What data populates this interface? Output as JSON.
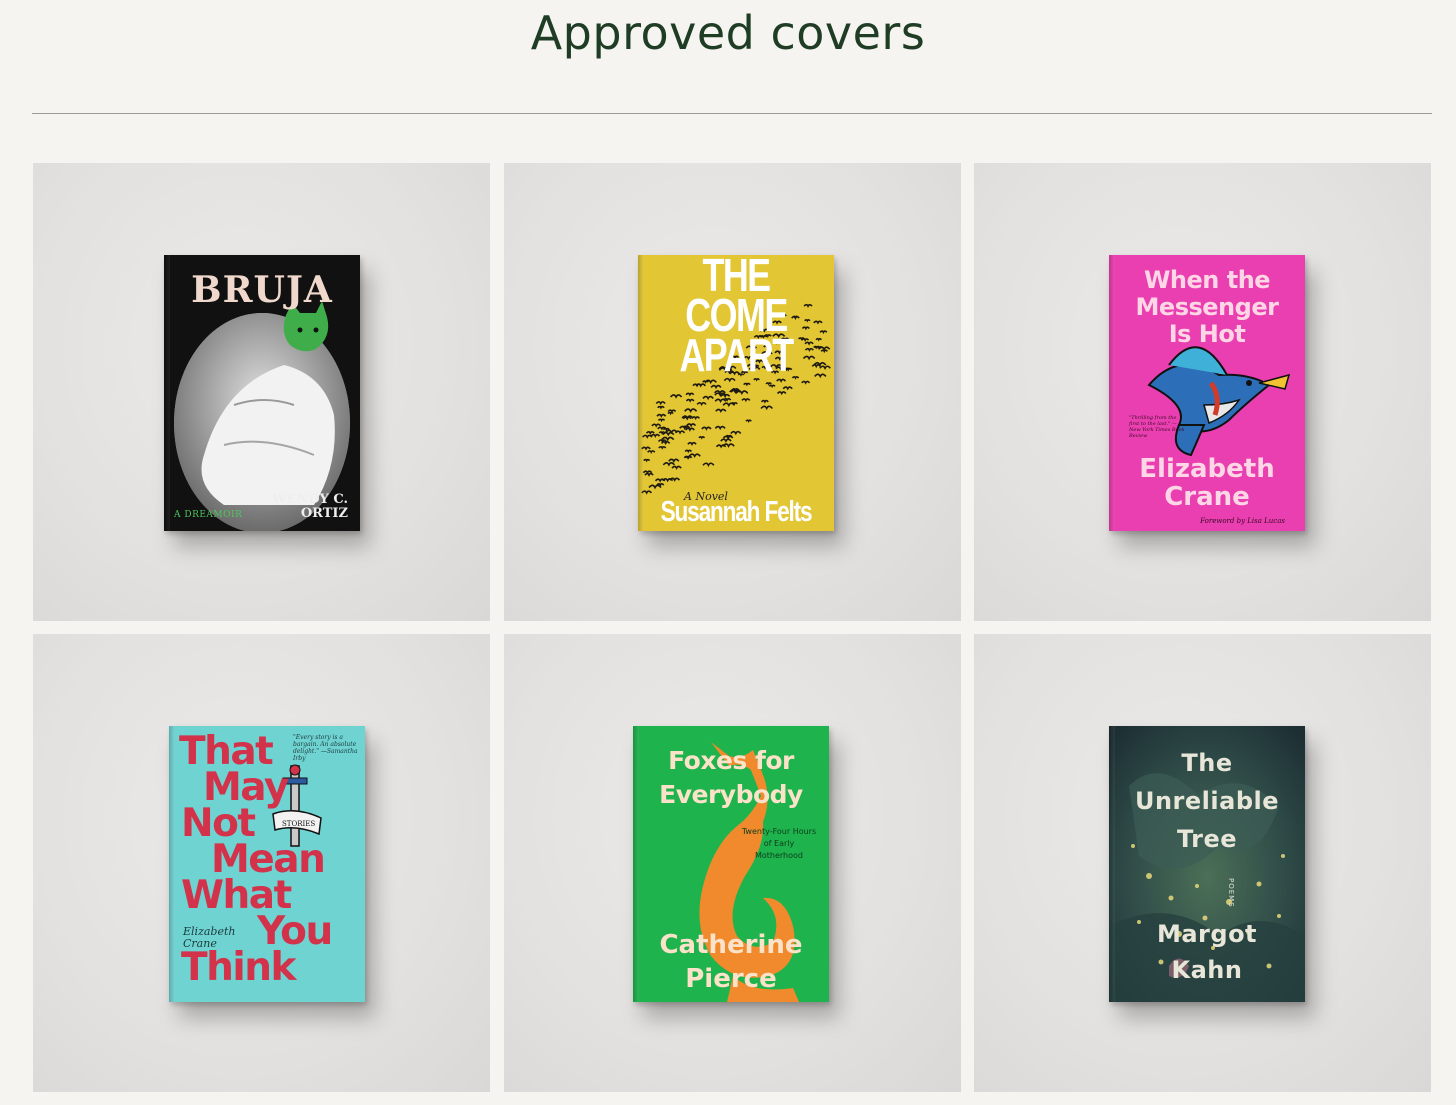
{
  "page": {
    "title": "Approved covers"
  },
  "covers": [
    {
      "title": "BRUJA",
      "author": "WENDY C. ORTIZ",
      "subtitle": "A DREAMOIR",
      "colors": {
        "bg": "#111111",
        "title": "#f0d9cc",
        "accent": "#4fc45e"
      }
    },
    {
      "title_lines": [
        "THE COME",
        "APART"
      ],
      "tagline": "A Novel",
      "author": "Susannah Felts",
      "colors": {
        "bg": "#e3c633",
        "title": "#ffffff"
      }
    },
    {
      "title_lines": [
        "When the",
        "Messenger",
        "Is Hot"
      ],
      "quote": "\"Thrilling from the first to the last.\" —New York Times Book Review",
      "author_lines": [
        "Elizabeth",
        "Crane"
      ],
      "foreword": "Foreword by Lisa Lucas",
      "colors": {
        "bg": "#ea3fb0",
        "title": "#ffd6e6"
      }
    },
    {
      "title_lines": [
        "That",
        "May",
        "Not",
        "Mean",
        "What",
        "You",
        "Think"
      ],
      "quote": "\"Every story is a bargain. An absolute delight.\" —Samantha Irby",
      "author": "Elizabeth Crane",
      "banner": "STORIES",
      "colors": {
        "bg": "#6fd3d2",
        "title": "#d2334b"
      }
    },
    {
      "title_lines": [
        "Foxes for",
        "Everybody"
      ],
      "subtitle": "Twenty-Four Hours of Early Motherhood",
      "author_lines": [
        "Catherine",
        "Pierce"
      ],
      "colors": {
        "bg": "#1fb34d",
        "title": "#fbe2c8",
        "fox": "#f08a2c"
      }
    },
    {
      "title_lines": [
        "The",
        "Unreliable",
        "Tree"
      ],
      "genre": "POEMS",
      "author_lines": [
        "Margot",
        "Kahn"
      ],
      "colors": {
        "bg": "#2d4446",
        "title": "#e8e6d8"
      }
    }
  ]
}
